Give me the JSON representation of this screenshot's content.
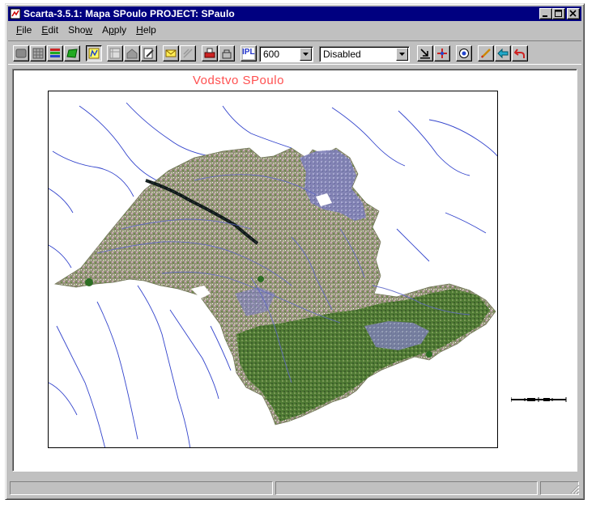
{
  "window": {
    "title": "Scarta-3.5.1: Mapa  SPoulo   PROJECT: SPaulo"
  },
  "menu": {
    "items": [
      {
        "label": "File",
        "mnemonic": "F",
        "rest": "ile"
      },
      {
        "label": "Edit",
        "mnemonic": "E",
        "rest": "dit"
      },
      {
        "label": "Show",
        "pre": "Sho",
        "mnemonic": "w",
        "rest": ""
      },
      {
        "label": "Apply",
        "pre": "A",
        "mnemonic": "p",
        "rest": "ply"
      },
      {
        "label": "Help",
        "mnemonic": "H",
        "rest": "elp"
      }
    ]
  },
  "toolbar": {
    "ipl_label": "IPL",
    "scale_value": "600",
    "mode_value": "Disabled"
  },
  "map": {
    "title": "Vodstvo SPoulo"
  },
  "status": {
    "pane1": "",
    "pane2": "",
    "pane3": ""
  },
  "colors": {
    "titlebar": "#000080",
    "map_title": "#ff5050",
    "rivers": "#3344cc",
    "land_green": "#6f8a50",
    "land_pink": "#a89098"
  }
}
